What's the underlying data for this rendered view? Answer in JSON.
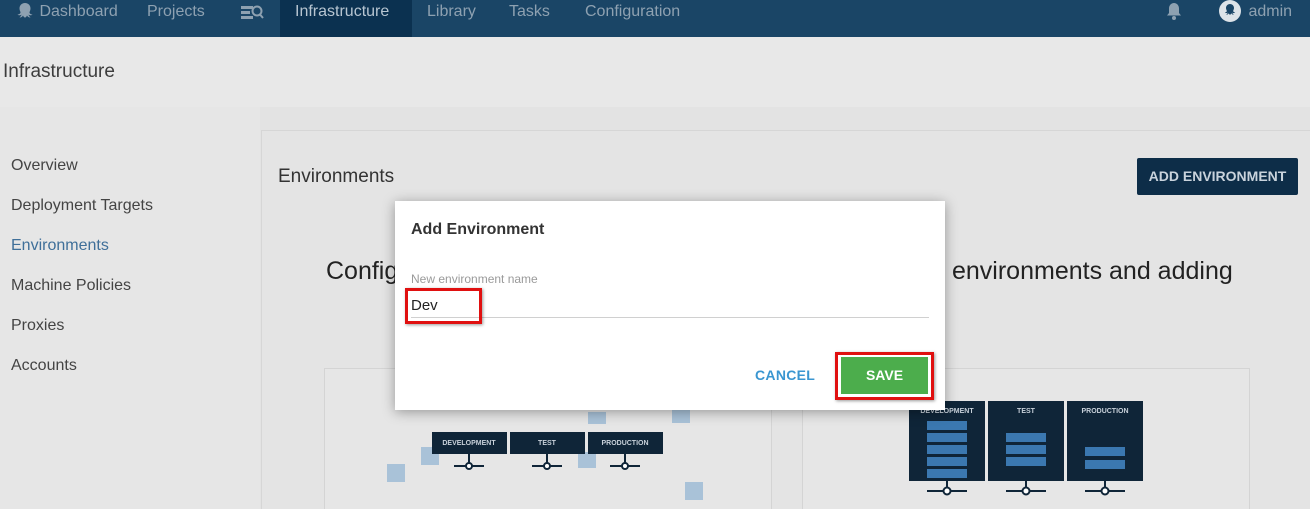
{
  "nav": {
    "items": [
      {
        "label": "Dashboard",
        "icon": "octopus-icon"
      },
      {
        "label": "Projects"
      },
      {
        "label": "",
        "icon": "search-icon"
      },
      {
        "label": "Infrastructure",
        "active": true
      },
      {
        "label": "Library"
      },
      {
        "label": "Tasks"
      },
      {
        "label": "Configuration"
      }
    ],
    "user": "admin",
    "colors": {
      "bar": "#1a4566",
      "active": "#0b3150"
    }
  },
  "page": {
    "title": "Infrastructure"
  },
  "sidebar": {
    "items": [
      {
        "label": "Overview"
      },
      {
        "label": "Deployment Targets"
      },
      {
        "label": "Environments",
        "active": true
      },
      {
        "label": "Machine Policies"
      },
      {
        "label": "Proxies"
      },
      {
        "label": "Accounts"
      }
    ]
  },
  "content": {
    "title": "Environments",
    "add_button": "ADD ENVIRONMENT",
    "intro_left": "Configu",
    "intro_right": "environments and adding",
    "illustration_labels": [
      "DEVELOPMENT",
      "TEST",
      "PRODUCTION"
    ]
  },
  "dialog": {
    "title": "Add Environment",
    "field_label": "New environment name",
    "field_value": "Dev",
    "cancel": "CANCEL",
    "save": "SAVE",
    "colors": {
      "save": "#4cad4c",
      "cancel": "#3a96d1",
      "highlight": "#e01010"
    }
  }
}
